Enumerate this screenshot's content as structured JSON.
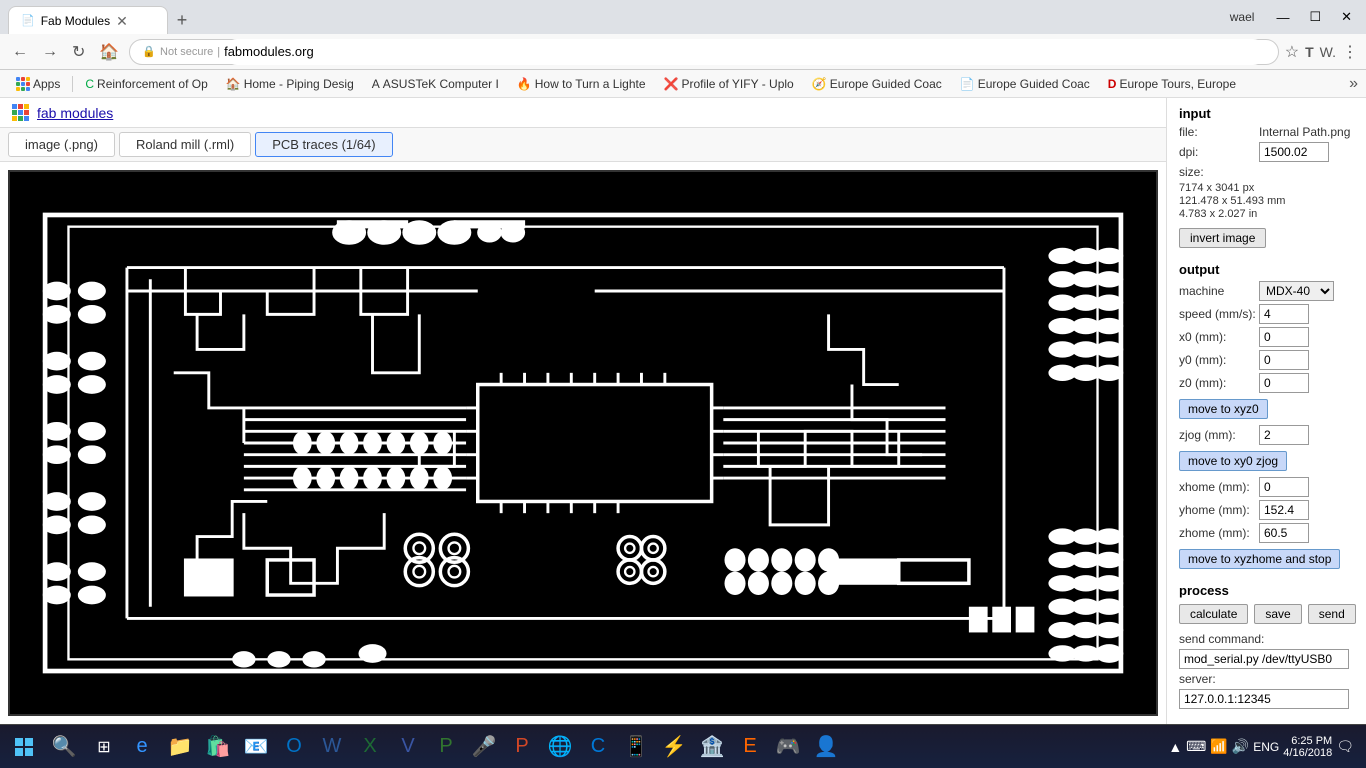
{
  "browser": {
    "tab_title": "Fab Modules",
    "tab_favicon": "📄",
    "url_secure": "Not secure",
    "url_domain": "fabmodules.org",
    "user_name": "wael",
    "window_controls": [
      "—",
      "☐",
      "✕"
    ]
  },
  "bookmarks": [
    {
      "label": "Apps",
      "type": "apps"
    },
    {
      "label": "Reinforcement of Op",
      "favicon": "C"
    },
    {
      "label": "Home - Piping Desig",
      "favicon": "🏠"
    },
    {
      "label": "ASUSTeK Computer I",
      "favicon": "A"
    },
    {
      "label": "How to Turn a Lighte",
      "favicon": "🔥"
    },
    {
      "label": "Profile of YIFY - Uplo",
      "favicon": "🎬"
    },
    {
      "label": "Europe Guided Coac",
      "favicon": "🧭"
    },
    {
      "label": "Europe Guided Coac",
      "favicon": "📄"
    },
    {
      "label": "Europe Tours, Europe",
      "favicon": "D"
    }
  ],
  "fab": {
    "logo_text": "fab modules",
    "tabs": [
      "image (.png)",
      "Roland mill (.rml)",
      "PCB traces (1/64)"
    ],
    "active_tab": 2
  },
  "input": {
    "section_title": "input",
    "file_label": "file:",
    "file_value": "Internal Path.png",
    "dpi_label": "dpi:",
    "dpi_value": "1500.02",
    "size_label": "size:",
    "size_px": "7174 x 3041 px",
    "size_mm": "121.478 x 51.493 mm",
    "size_in": "4.783 x 2.027 in",
    "invert_btn": "invert image"
  },
  "output": {
    "section_title": "output",
    "machine_label": "machine",
    "machine_value": "MDX-40",
    "speed_label": "speed (mm/s):",
    "speed_value": "4",
    "x0_label": "x0 (mm):",
    "x0_value": "0",
    "y0_label": "y0 (mm):",
    "y0_value": "0",
    "z0_label": "z0 (mm):",
    "z0_value": "0",
    "move_xyz_btn": "move to xyz0",
    "zjog_label": "zjog (mm):",
    "zjog_value": "2",
    "move_xyjog_btn": "move to xy0 zjog",
    "xhome_label": "xhome (mm):",
    "xhome_value": "0",
    "yhome_label": "yhome (mm):",
    "yhome_value": "152.4",
    "zhome_label": "zhome (mm):",
    "zhome_value": "60.5",
    "move_xyzhome_btn": "move to xyzhome and stop"
  },
  "process": {
    "section_title": "process",
    "calculate_btn": "calculate",
    "save_btn": "save",
    "send_btn": "send",
    "send_command_label": "send command:",
    "send_command_value": "mod_serial.py /dev/ttyUSB0",
    "server_label": "server:",
    "server_value": "127.0.0.1:12345"
  },
  "taskbar": {
    "clock": "6:25 PM\n4/16/2018",
    "language": "ENG",
    "notification_action": "▲",
    "wifi": "WiFi",
    "volume": "🔊"
  }
}
